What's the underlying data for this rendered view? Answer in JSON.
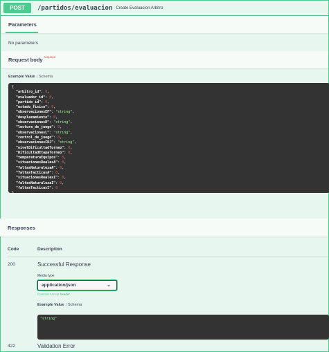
{
  "operation": {
    "method": "POST",
    "path": "/partidos/evaluacion",
    "summary": "Create Evaluacion Arbitro",
    "accent_color": "#49cc90"
  },
  "parameters": {
    "tab_label": "Parameters",
    "empty_text": "No parameters"
  },
  "request_body": {
    "title": "Request body",
    "required_label": "required",
    "example_tab": "Example Value",
    "schema_tab": "Schema",
    "open_brace": "{",
    "close_brace": "}",
    "fields": [
      {
        "key": "\"arbitro_id\"",
        "value": "0",
        "type": "number"
      },
      {
        "key": "\"evaluador_id\"",
        "value": "0",
        "type": "number"
      },
      {
        "key": "\"partido_id\"",
        "value": "0",
        "type": "number"
      },
      {
        "key": "\"estado_fisico\"",
        "value": "0",
        "type": "number"
      },
      {
        "key": "\"observacionesEF\"",
        "value": "\"string\"",
        "type": "string"
      },
      {
        "key": "\"desplazamiento\"",
        "value": "0",
        "type": "number"
      },
      {
        "key": "\"observacionesD\"",
        "value": "\"string\"",
        "type": "string"
      },
      {
        "key": "\"lectura_de_juego\"",
        "value": "0",
        "type": "number"
      },
      {
        "key": "\"observacionesL\"",
        "value": "\"string\"",
        "type": "string"
      },
      {
        "key": "\"control_de_juego\"",
        "value": "0",
        "type": "number"
      },
      {
        "key": "\"observacionesCDJ\"",
        "value": "\"string\"",
        "type": "string"
      },
      {
        "key": "\"nivelDificultadTorneo\"",
        "value": "0",
        "type": "number"
      },
      {
        "key": "\"DificultadEtapaTorneo\"",
        "value": "0",
        "type": "number"
      },
      {
        "key": "\"temperaturaEquipos\"",
        "value": "0",
        "type": "number"
      },
      {
        "key": "\"situacionesRealesA\"",
        "value": "0",
        "type": "number"
      },
      {
        "key": "\"faltasNaturalezaA\"",
        "value": "0",
        "type": "number"
      },
      {
        "key": "\"faltasTacticasA\"",
        "value": "0",
        "type": "number"
      },
      {
        "key": "\"situacionesRealesI\"",
        "value": "0",
        "type": "number"
      },
      {
        "key": "\"faltasNaturalezaI\"",
        "value": "0",
        "type": "number"
      },
      {
        "key": "\"faltasTacticasI\"",
        "value": "0",
        "type": "number"
      }
    ]
  },
  "responses": {
    "title": "Responses",
    "col_code": "Code",
    "col_description": "Description",
    "items": [
      {
        "code": "200",
        "description": "Successful Response",
        "media_type_label": "Media type",
        "media_type_value": "application/json",
        "controls_prefix": "Controls",
        "controls_mid": "Accept",
        "controls_suffix": "header.",
        "example_tab": "Example Value",
        "schema_tab": "Schema",
        "example": "\"string\""
      },
      {
        "code": "422",
        "description": "Validation Error"
      }
    ]
  }
}
